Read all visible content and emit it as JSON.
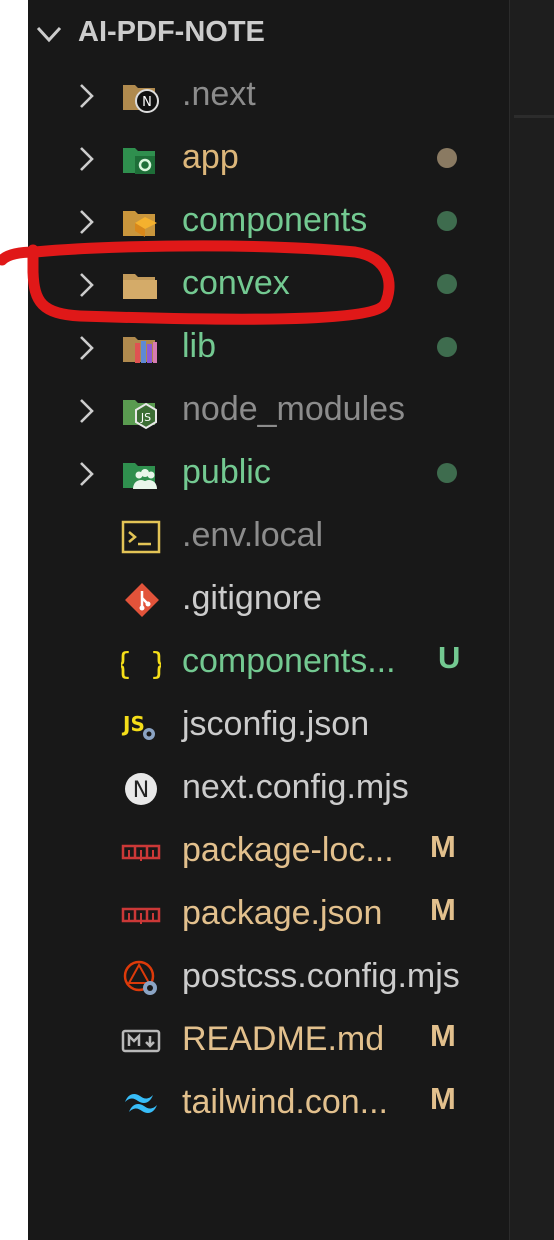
{
  "explorer": {
    "root_label": "AI-PDF-NOTE",
    "items": [
      {
        "label": ".next",
        "kind": "folder",
        "icon": "next-folder-icon",
        "color": "#8c8c8c"
      },
      {
        "label": "app",
        "kind": "folder",
        "icon": "app-folder-icon",
        "color": "#dcb67a",
        "status": "modified",
        "status_color": "#8a7a62"
      },
      {
        "label": "components",
        "kind": "folder",
        "icon": "components-folder-icon",
        "color": "#73c991",
        "status": "untracked",
        "status_color": "#3e6c4e"
      },
      {
        "label": "convex",
        "kind": "folder",
        "icon": "folder-icon",
        "color": "#73c991",
        "status": "untracked",
        "status_color": "#3e6c4e",
        "highlighted": true
      },
      {
        "label": "lib",
        "kind": "folder",
        "icon": "lib-folder-icon",
        "color": "#73c991",
        "status": "untracked",
        "status_color": "#3e6c4e"
      },
      {
        "label": "node_modules",
        "kind": "folder",
        "icon": "node-modules-folder-icon",
        "color": "#8c8c8c"
      },
      {
        "label": "public",
        "kind": "folder",
        "icon": "public-folder-icon",
        "color": "#73c991",
        "status": "untracked",
        "status_color": "#3e6c4e"
      },
      {
        "label": ".env.local",
        "kind": "file",
        "icon": "terminal-file-icon",
        "color": "#8c8c8c"
      },
      {
        "label": ".gitignore",
        "kind": "file",
        "icon": "git-icon",
        "color": "#cccccc"
      },
      {
        "label": "components...",
        "kind": "file",
        "icon": "json-braces-icon",
        "color": "#73c991",
        "badge": "U",
        "badge_color": "#73c991"
      },
      {
        "label": "jsconfig.json",
        "kind": "file",
        "icon": "js-config-icon",
        "color": "#cccccc"
      },
      {
        "label": "next.config.mjs",
        "kind": "file",
        "icon": "next-icon",
        "color": "#cccccc"
      },
      {
        "label": "package-loc...",
        "kind": "file",
        "icon": "npm-icon",
        "color": "#e2c08d",
        "badge": "M",
        "badge_color": "#e2c08d"
      },
      {
        "label": "package.json",
        "kind": "file",
        "icon": "npm-icon",
        "color": "#e2c08d",
        "badge": "M",
        "badge_color": "#e2c08d"
      },
      {
        "label": "postcss.config.mjs",
        "kind": "file",
        "icon": "postcss-icon",
        "color": "#cccccc"
      },
      {
        "label": "README.md",
        "kind": "file",
        "icon": "markdown-icon",
        "color": "#e2c08d",
        "badge": "M",
        "badge_color": "#e2c08d"
      },
      {
        "label": "tailwind.con...",
        "kind": "file",
        "icon": "tailwind-icon",
        "color": "#e2c08d",
        "badge": "M",
        "badge_color": "#e2c08d"
      }
    ]
  },
  "annotation": {
    "color": "#e01818"
  }
}
